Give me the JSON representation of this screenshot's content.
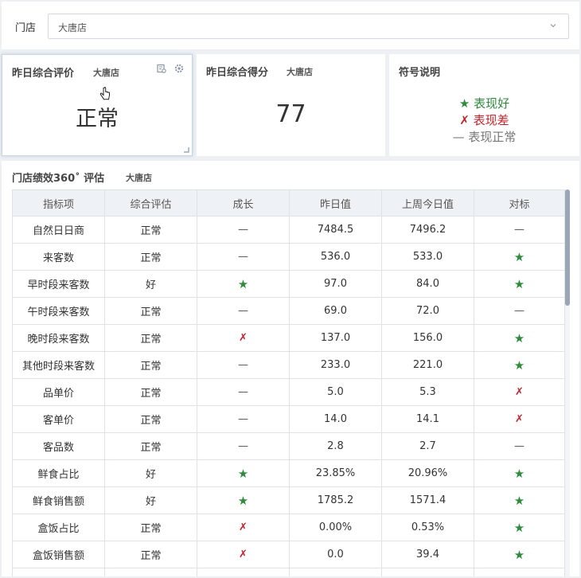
{
  "filter": {
    "label": "门店",
    "value": "大唐店"
  },
  "card_rating": {
    "title": "昨日综合评价",
    "store": "大唐店",
    "value": "正常"
  },
  "card_score": {
    "title": "昨日综合得分",
    "store": "大唐店",
    "value": "77"
  },
  "card_legend": {
    "title": "符号说明",
    "good": {
      "mark": "★",
      "text": "表现好"
    },
    "bad": {
      "mark": "✗",
      "text": "表现差"
    },
    "normal": {
      "mark": "—",
      "text": "表现正常"
    }
  },
  "panel": {
    "title": "门店绩效360˚ 评估",
    "store": "大唐店"
  },
  "table": {
    "headers": [
      "指标项",
      "综合评估",
      "成长",
      "昨日值",
      "上周今日值",
      "对标"
    ],
    "rows": [
      [
        "自然日日商",
        "正常",
        "—",
        "7484.5",
        "7496.2",
        "—"
      ],
      [
        "来客数",
        "正常",
        "—",
        "536.0",
        "533.0",
        "★"
      ],
      [
        "早时段来客数",
        "好",
        "★",
        "97.0",
        "84.0",
        "★"
      ],
      [
        "午时段来客数",
        "正常",
        "—",
        "69.0",
        "72.0",
        "—"
      ],
      [
        "晚时段来客数",
        "正常",
        "✗",
        "137.0",
        "156.0",
        "★"
      ],
      [
        "其他时段来客数",
        "正常",
        "—",
        "233.0",
        "221.0",
        "★"
      ],
      [
        "品单价",
        "正常",
        "—",
        "5.0",
        "5.3",
        "✗"
      ],
      [
        "客单价",
        "正常",
        "—",
        "14.0",
        "14.1",
        "✗"
      ],
      [
        "客品数",
        "正常",
        "—",
        "2.8",
        "2.7",
        "—"
      ],
      [
        "鲜食占比",
        "好",
        "★",
        "23.85%",
        "20.96%",
        "★"
      ],
      [
        "鲜食销售额",
        "好",
        "★",
        "1785.2",
        "1571.4",
        "★"
      ],
      [
        "盒饭占比",
        "正常",
        "✗",
        "0.00%",
        "0.53%",
        "★"
      ],
      [
        "盒饭销售额",
        "正常",
        "✗",
        "0.0",
        "39.4",
        "★"
      ],
      [
        "",
        "",
        "",
        "",
        "",
        ""
      ]
    ]
  },
  "colors": {
    "good": "#2e8b3a",
    "bad": "#c0242b",
    "header_bg": "#eef2f7"
  },
  "icons": {
    "dropdown": "chevron-down-icon",
    "export": "export-icon",
    "settings": "gear-icon",
    "cursor": "hand-pointer-icon"
  }
}
